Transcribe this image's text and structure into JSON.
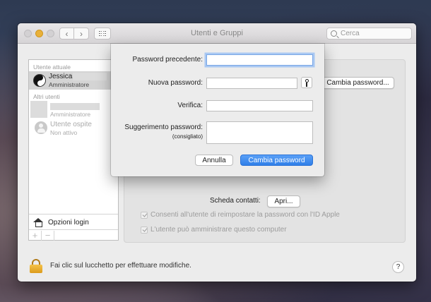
{
  "window": {
    "title": "Utenti e Gruppi",
    "search_placeholder": "Cerca"
  },
  "sidebar": {
    "current_user_header": "Utente attuale",
    "current_user": {
      "name": "Jessica",
      "role": "Amministratore"
    },
    "other_users_header": "Altri utenti",
    "other_user": {
      "role": "Amministratore"
    },
    "guest_user": {
      "name": "Utente ospite",
      "status": "Non attivo"
    },
    "login_options": "Opzioni login",
    "add": "+",
    "remove": "−"
  },
  "main": {
    "change_password_button": "Cambia password...",
    "contact_card_label": "Scheda contatti:",
    "open_button": "Apri...",
    "checkbox_reset": "Consenti all'utente di reimpostare la password con l'ID Apple",
    "checkbox_admin": "L'utente può amministrare questo computer"
  },
  "footer": {
    "lock_text": "Fai clic sul lucchetto per effettuare modifiche.",
    "help": "?"
  },
  "sheet": {
    "old_password_label": "Password precedente:",
    "old_password_value": "",
    "new_password_label": "Nuova password:",
    "new_password_value": "",
    "verify_label": "Verifica:",
    "verify_value": "",
    "hint_label": "Suggerimento password:",
    "hint_sublabel": "(consigliato)",
    "hint_value": "",
    "cancel_button": "Annulla",
    "confirm_button": "Cambia password"
  }
}
